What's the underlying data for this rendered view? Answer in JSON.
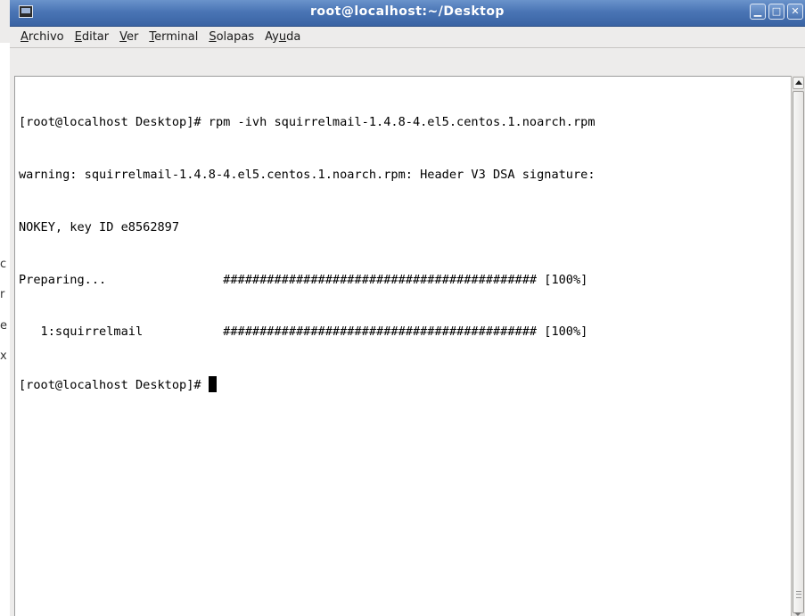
{
  "window": {
    "title": "root@localhost:~/Desktop",
    "buttons": [
      "minimize",
      "maximize",
      "close"
    ]
  },
  "menubar": {
    "items": [
      {
        "label": "Archivo",
        "mnemonic_index": 0
      },
      {
        "label": "Editar",
        "mnemonic_index": 0
      },
      {
        "label": "Ver",
        "mnemonic_index": 0
      },
      {
        "label": "Terminal",
        "mnemonic_index": 0
      },
      {
        "label": "Solapas",
        "mnemonic_index": 0
      },
      {
        "label": "Ayuda",
        "mnemonic_index": 2
      }
    ]
  },
  "terminal": {
    "lines": [
      "[root@localhost Desktop]# rpm -ivh squirrelmail-1.4.8-4.el5.centos.1.noarch.rpm",
      "warning: squirrelmail-1.4.8-4.el5.centos.1.noarch.rpm: Header V3 DSA signature:",
      "NOKEY, key ID e8562897",
      "Preparing...                ########################################### [100%]",
      "   1:squirrelmail           ########################################### [100%]"
    ],
    "prompt": "[root@localhost Desktop]# "
  },
  "background_window": {
    "fragments": [
      "c",
      "r",
      "e",
      "x"
    ]
  },
  "colors": {
    "titlebar": "#4a75b5",
    "terminal_bg": "#ffffff",
    "terminal_fg": "#000000"
  }
}
